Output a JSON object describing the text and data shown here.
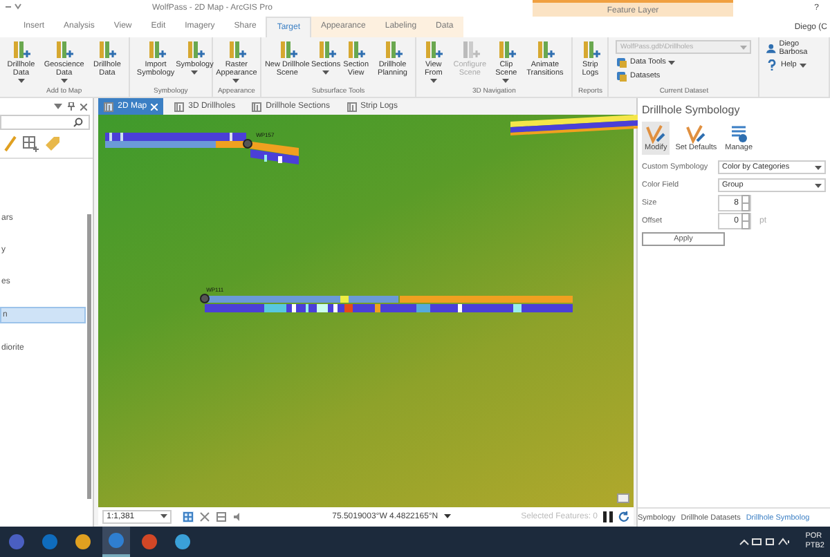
{
  "window": {
    "title": "WolfPass - 2D Map - ArcGIS Pro",
    "contextual_group": "Feature Layer",
    "help": "?",
    "user": "Diego (C"
  },
  "ribbon_tabs": [
    {
      "label": "Insert",
      "selected": false
    },
    {
      "label": "Analysis",
      "selected": false
    },
    {
      "label": "View",
      "selected": false
    },
    {
      "label": "Edit",
      "selected": false
    },
    {
      "label": "Imagery",
      "selected": false
    },
    {
      "label": "Share",
      "selected": false
    },
    {
      "label": "Target",
      "selected": true
    },
    {
      "label": "Appearance",
      "selected": false
    },
    {
      "label": "Labeling",
      "selected": false
    },
    {
      "label": "Data",
      "selected": false
    }
  ],
  "ribbon_groups": [
    {
      "kind": "buttons",
      "label": "Add to Map",
      "buttons": [
        {
          "label": "Drillhole Data",
          "dropdown": true,
          "disabled": false
        },
        {
          "label": "Geoscience Data",
          "dropdown": true,
          "disabled": false
        },
        {
          "label": "Drillhole Data",
          "dropdown": false,
          "disabled": false
        }
      ]
    },
    {
      "kind": "buttons",
      "label": "Symbology",
      "buttons": [
        {
          "label": "Import Symbology",
          "dropdown": false,
          "disabled": false
        },
        {
          "label": "Symbology",
          "dropdown": true,
          "disabled": false
        }
      ]
    },
    {
      "kind": "buttons",
      "label": "Appearance",
      "buttons": [
        {
          "label": "Raster Appearance",
          "dropdown": true,
          "disabled": false
        }
      ]
    },
    {
      "kind": "buttons",
      "label": "Subsurface Tools",
      "buttons": [
        {
          "label": "New Drillhole Scene",
          "dropdown": false,
          "disabled": false
        },
        {
          "label": "Sections",
          "dropdown": true,
          "disabled": false
        },
        {
          "label": "Section View",
          "dropdown": false,
          "disabled": false
        },
        {
          "label": "Drillhole Planning",
          "dropdown": false,
          "disabled": false
        }
      ]
    },
    {
      "kind": "buttons",
      "label": "3D Navigation",
      "buttons": [
        {
          "label": "View From",
          "dropdown": true,
          "disabled": false
        },
        {
          "label": "Configure Scene",
          "dropdown": false,
          "disabled": true
        },
        {
          "label": "Clip Scene",
          "dropdown": true,
          "disabled": false
        },
        {
          "label": "Animate Transitions",
          "dropdown": false,
          "disabled": false
        }
      ]
    },
    {
      "kind": "buttons",
      "label": "Reports",
      "buttons": [
        {
          "label": "Strip Logs",
          "dropdown": false,
          "disabled": false
        }
      ]
    },
    {
      "kind": "dataset",
      "label": "Current Dataset",
      "field": "WolfPass.gdb\\Drillholes",
      "buttons": [
        {
          "label": "Data Tools",
          "dropdown": true,
          "disabled": false
        },
        {
          "label": "Datasets",
          "dropdown": false,
          "disabled": false
        }
      ]
    },
    {
      "kind": "account",
      "buttons": [
        {
          "label": "Diego Barbosa",
          "dropdown": false,
          "disabled": false
        },
        {
          "label": "Help",
          "dropdown": true,
          "disabled": false
        }
      ]
    }
  ],
  "contents_pane": {
    "items": [
      {
        "label": "ars",
        "selected": false
      },
      {
        "label": "y",
        "selected": false
      },
      {
        "label": "es",
        "selected": false
      },
      {
        "label": "n",
        "selected": true
      },
      {
        "label": "diorite",
        "selected": false
      }
    ]
  },
  "doc_tabs": [
    {
      "label": "2D Map",
      "selected": true
    },
    {
      "label": "3D Drillholes",
      "selected": false
    },
    {
      "label": "Drillhole Sections",
      "selected": false
    },
    {
      "label": "Strip Logs",
      "selected": false
    }
  ],
  "map": {
    "hole_labels": [
      "WP157",
      "WP111"
    ],
    "scale": "1:1,381",
    "coordinates": "75.5019003°W 4.4822165°N",
    "selected_features": "Selected Features: 0"
  },
  "symbology_pane": {
    "title": "Drillhole Symbology",
    "tools": [
      {
        "label": "Modify",
        "selected": true
      },
      {
        "label": "Set Defaults",
        "selected": false
      },
      {
        "label": "Manage",
        "selected": false
      }
    ],
    "fields": [
      {
        "label": "Custom Symbology",
        "kind": "dropdown",
        "value": "Color by Categories"
      },
      {
        "label": "Color Field",
        "kind": "dropdown",
        "value": "Group"
      },
      {
        "label": "Size",
        "kind": "spinner",
        "value": "8"
      },
      {
        "label": "Offset",
        "kind": "spinner",
        "value": "0",
        "unit": "pt"
      }
    ],
    "apply": "Apply"
  },
  "pane_tabs": [
    {
      "label": "Symbology",
      "selected": false
    },
    {
      "label": "Drillhole Datasets",
      "selected": false
    },
    {
      "label": "Drillhole Symbolog",
      "selected": true
    }
  ],
  "taskbar": {
    "apps": [
      {
        "color": "#4a5fc1",
        "active": false
      },
      {
        "color": "#0f6cbd",
        "active": false
      },
      {
        "color": "#e0a020",
        "active": false
      },
      {
        "color": "#2f7fd0",
        "active": true
      },
      {
        "color": "#d24726",
        "active": false
      },
      {
        "color": "#3aa0d8",
        "active": false
      }
    ],
    "language": "POR",
    "layout": "PTB2"
  }
}
